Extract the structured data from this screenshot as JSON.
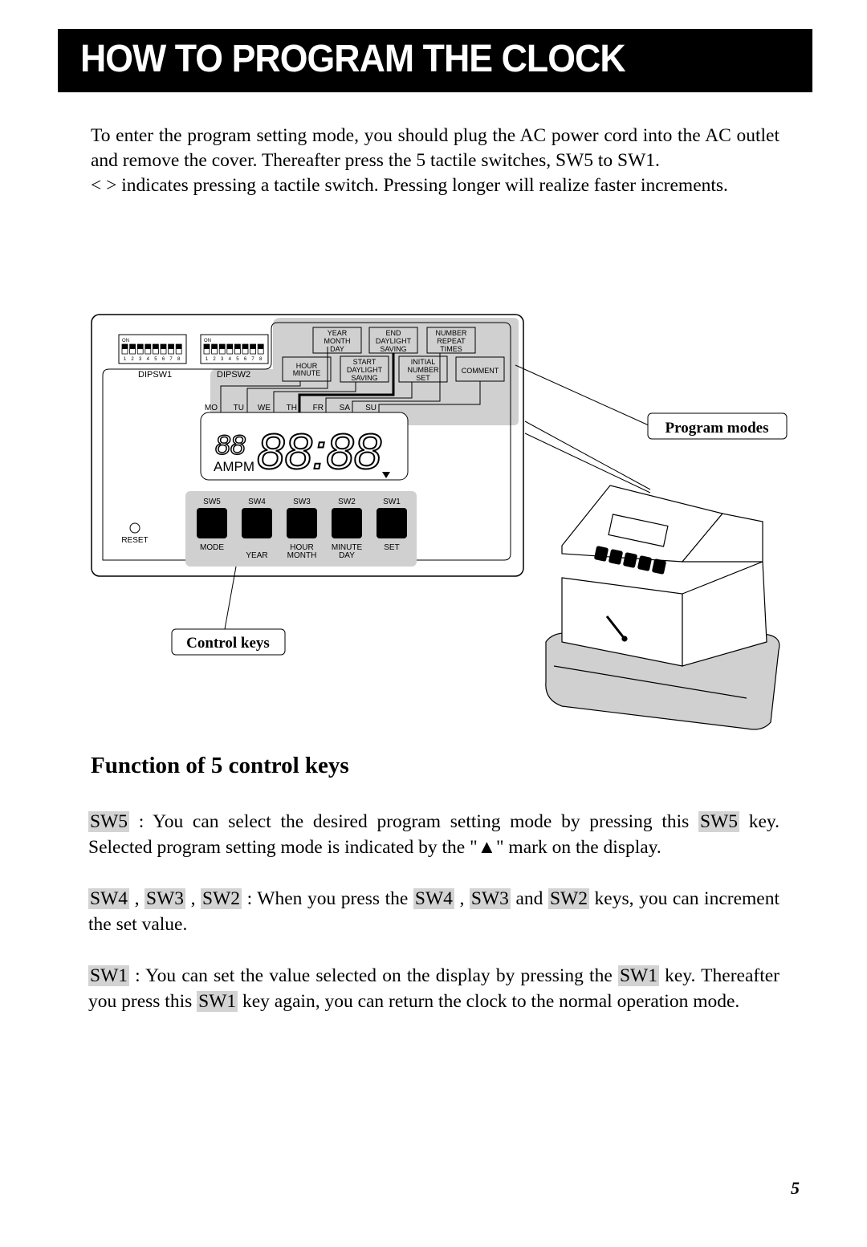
{
  "page": {
    "title": "HOW TO PROGRAM THE CLOCK",
    "page_number": "5"
  },
  "intro": {
    "paragraph1": "To enter the program setting mode, you should plug the AC power cord into the AC outlet and remove the cover. Thereafter press the 5 tactile switches, SW5 to SW1.",
    "paragraph2": "< > indicates pressing a tactile switch. Pressing longer will realize faster increments."
  },
  "diagram": {
    "dip_switches": [
      {
        "label": "DIPSW1",
        "on_label": "ON",
        "positions": [
          "1",
          "2",
          "3",
          "4",
          "5",
          "6",
          "7",
          "8"
        ]
      },
      {
        "label": "DIPSW2",
        "on_label": "ON",
        "positions": [
          "1",
          "2",
          "3",
          "4",
          "5",
          "6",
          "7",
          "8"
        ]
      }
    ],
    "mode_boxes_top": [
      {
        "lines": [
          "YEAR",
          "MONTH",
          "DAY"
        ]
      },
      {
        "lines": [
          "END",
          "DAYLIGHT",
          "SAVING"
        ]
      },
      {
        "lines": [
          "NUMBER",
          "REPEAT",
          "TIMES"
        ]
      }
    ],
    "mode_boxes_bottom": [
      {
        "lines": [
          "HOUR",
          "MINUTE"
        ]
      },
      {
        "lines": [
          "START",
          "DAYLIGHT",
          "SAVING"
        ]
      },
      {
        "lines": [
          "INITIAL",
          "NUMBER",
          "SET"
        ]
      },
      {
        "lines": [
          "COMMENT"
        ]
      }
    ],
    "days": [
      "MO",
      "TU",
      "WE",
      "TH",
      "FR",
      "SA",
      "SU"
    ],
    "display": {
      "small_digits": "88",
      "main_digits": "88:88",
      "ampm": "AMPM"
    },
    "keys": [
      {
        "id": "SW5",
        "function_line1": "MODE",
        "function_line2": ""
      },
      {
        "id": "SW4",
        "function_line1": "",
        "function_line2": "YEAR"
      },
      {
        "id": "SW3",
        "function_line1": "HOUR",
        "function_line2": "MONTH"
      },
      {
        "id": "SW2",
        "function_line1": "MINUTE",
        "function_line2": "DAY"
      },
      {
        "id": "SW1",
        "function_line1": "SET",
        "function_line2": ""
      }
    ],
    "reset_label": "RESET",
    "callout_program_modes": "Program modes",
    "callout_control_keys": "Control keys"
  },
  "functions": {
    "heading": "Function of 5 control keys",
    "sw5": {
      "keys": [
        "SW5"
      ],
      "text_a": " : You can select the desired program setting mode by pressing this ",
      "key_inline": "SW5",
      "text_b": " key. Selected program setting mode is indicated by the \"▲\" mark on the display."
    },
    "sw432": {
      "keys": [
        "SW4",
        "SW3",
        "SW2"
      ],
      "sep": " , ",
      "text_a": " : When you press the ",
      "inline_keys": [
        "SW4",
        "SW3",
        "SW2"
      ],
      "and": " and ",
      "text_b": " keys, you can increment the set value."
    },
    "sw1": {
      "keys": [
        "SW1"
      ],
      "text_a": " : You can set the value selected on the display by pressing the ",
      "key_inline": "SW1",
      "text_b": " key. Thereafter you press this ",
      "key_inline2": "SW1",
      "text_c": " key again, you can return the clock to the normal operation mode."
    }
  }
}
